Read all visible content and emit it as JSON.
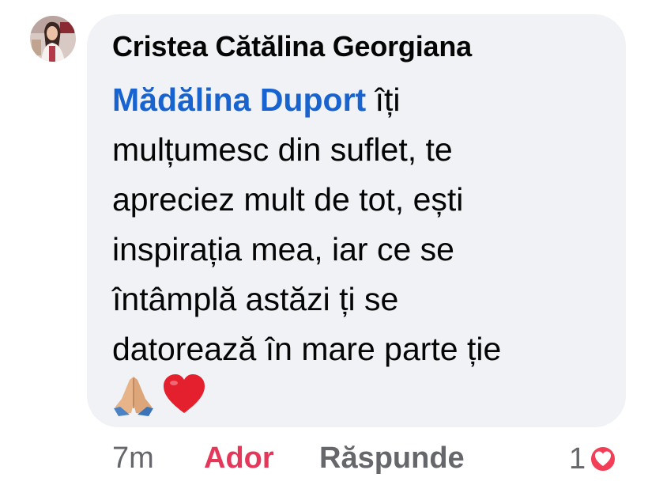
{
  "comment": {
    "author": "Cristea Cătălina Georgiana",
    "mention": "Mădălina Duport",
    "text_lines": [
      " îți",
      "mulțumesc din suflet, te",
      "apreciez mult de tot, ești",
      "inspirația mea, iar ce se",
      "întâmplă astăzi ți se",
      "datorează în mare parte ție"
    ],
    "emojis": [
      "folded-hands-emoji",
      "red-heart-emoji"
    ]
  },
  "actions": {
    "time": "7m",
    "reaction_label": "Ador",
    "reply_label": "Răspunde"
  },
  "reactions": {
    "count": "1",
    "icon": "love-reaction-icon"
  },
  "colors": {
    "bubble": "#f0f2f5",
    "mention": "#1763cf",
    "reaction_active": "#e4375a",
    "muted": "#65676b"
  }
}
